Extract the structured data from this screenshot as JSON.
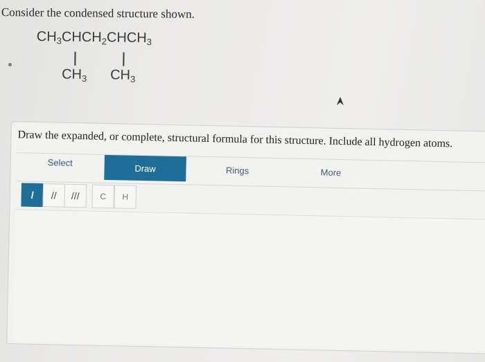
{
  "question": {
    "text": "Consider the condensed structure shown."
  },
  "structure": {
    "main_parts": [
      "CH",
      "3",
      "CHCH",
      "2",
      "CHCH",
      "3"
    ],
    "branch1": [
      "CH",
      "3"
    ],
    "branch2": [
      "CH",
      "3"
    ]
  },
  "panel": {
    "prompt": "Draw the expanded, or complete, structural formula for this structure. Include all hydrogen atoms.",
    "tabs": {
      "select": "Select",
      "draw": "Draw",
      "rings": "Rings",
      "more": "More"
    },
    "tools": {
      "single": "/",
      "double": "//",
      "triple": "///",
      "carbon": "C",
      "hydrogen": "H"
    }
  },
  "colors": {
    "accent": "#1f6e97",
    "tab_text": "#3f5e79"
  },
  "icons": {
    "pointer": "cursor-arrow-icon",
    "bullet": "bullet-dot-icon"
  }
}
